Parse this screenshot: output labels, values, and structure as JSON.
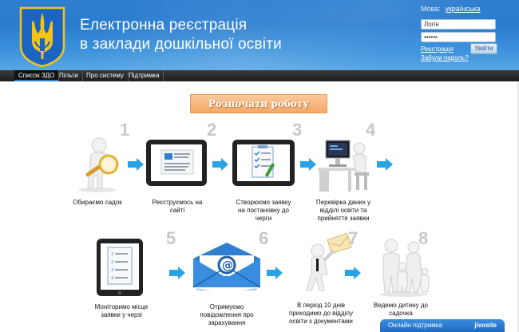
{
  "header": {
    "title_line1": "Електронна реєстрація",
    "title_line2": "в заклади дошкільної освіти",
    "logo_icon": "trident-coat-of-arms-icon"
  },
  "login": {
    "lang_label": "Мова:",
    "lang_value": "українська",
    "login_value": "Логін",
    "password_value": "••••••",
    "register_link": "Реєстрація",
    "forgot_link": "Забули пароль?",
    "submit_label": "Увійти"
  },
  "nav": {
    "items": [
      {
        "label": "Список ЗДО"
      },
      {
        "label": "Пільги"
      },
      {
        "label": "Про систему"
      },
      {
        "label": "Підтримка"
      }
    ]
  },
  "main": {
    "start_label": "Розпочати роботу",
    "steps": [
      {
        "number": "1",
        "caption": "Обираємо садок",
        "icon": "magnifier-person-icon"
      },
      {
        "number": "2",
        "caption": "Реєструємось на сайті",
        "icon": "tablet-registration-icon"
      },
      {
        "number": "3",
        "caption": "Створюємо заявку на постановку до черги",
        "icon": "tablet-checklist-icon"
      },
      {
        "number": "4",
        "caption": "Перевірка даних у відділі освіти та прийняття заявки",
        "icon": "computer-desk-icon"
      },
      {
        "number": "5",
        "caption": "Моніторимо місце заявки у черзі",
        "icon": "tablet-list-icon"
      },
      {
        "number": "6",
        "caption": "Отримуємо повідомлення про зарахування",
        "icon": "email-envelope-icon"
      },
      {
        "number": "7",
        "caption": "В період 10 днів приходимо до відділу освіти з документами",
        "icon": "person-with-letter-icon"
      },
      {
        "number": "8",
        "caption": "Ведемо дитину до садочка",
        "icon": "family-icon"
      }
    ]
  },
  "chat": {
    "label": "Онлайн підтримка",
    "brand": "jivosite"
  },
  "colors": {
    "header_blue": "#2f7fd0",
    "nav_dark": "#1d1d1d",
    "start_orange": "#f4a866",
    "arrow_blue": "#2aa3e6",
    "step_number_gray": "#c8c8c8"
  }
}
